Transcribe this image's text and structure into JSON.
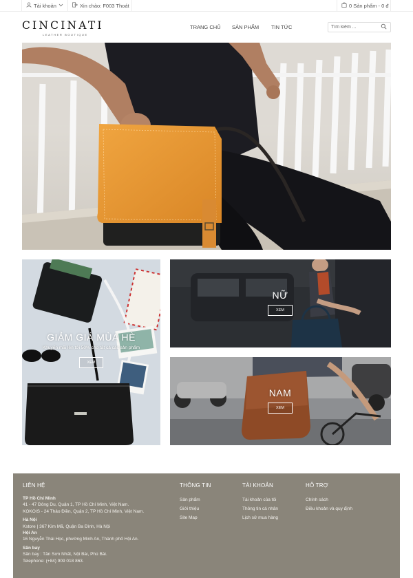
{
  "topbar": {
    "account_label": "Tài khoản",
    "greeting": "Xin chào: F003 Thoát",
    "cart": "0 Sản phẩm - 0 đ"
  },
  "header": {
    "brand": "CINCINATI",
    "tagline": "LEATHER BOUTIQUE",
    "nav": [
      "TRANG CHỦ",
      "SẢN PHẨM",
      "TIN TỨC"
    ],
    "search_placeholder": "Tìm kiếm ..."
  },
  "tiles": {
    "sale": {
      "title": "GIẢM GIÁ MÙA HÈ",
      "subtitle": "Khuyến mãi lên tới 50% cho tất cả các sản phẩm",
      "button": "XEM"
    },
    "women": {
      "title": "NỮ",
      "button": "XEM"
    },
    "men": {
      "title": "NAM",
      "button": "XEM"
    }
  },
  "footer": {
    "contact": {
      "heading": "LIÊN HỆ",
      "hcm_title": "TP Hồ Chí Minh",
      "hcm_1": "41 - 47 Đông Du, Quận 1, TP Hồ Chí Minh, Việt Nam.",
      "hcm_2": "KOKOIS - 24 Thảo Điền, Quận 2, TP Hồ Chí Minh, Việt Nam.",
      "hn_title": "Hà Nội",
      "hn_1": "Kstore | 367 Kim Mã, Quận Ba Đình, Hà Nội",
      "ha_title": "Hội An",
      "ha_1": "16 Nguyễn Thái Học, phường Minh An, Thành phố Hội An.",
      "ap_title": "Sân bay",
      "ap_1": "Sân bay : Tân Sơn Nhất, Nội Bài, Phú Bài.",
      "phone": "Telephone: (+84) 909 018 863."
    },
    "info": {
      "heading": "THÔNG TIN",
      "links": [
        "Sản phẩm",
        "Giới thiệu",
        "Site Map"
      ]
    },
    "account": {
      "heading": "TÀI KHOẢN",
      "links": [
        "Tài khoản của tôi",
        "Thông tin cá nhân",
        "Lịch sử mua hàng"
      ]
    },
    "support": {
      "heading": "HỖ TRỢ",
      "links": [
        "Chính sách",
        "Điều khoản và quy định"
      ]
    }
  },
  "colors": {
    "footer_bg": "#8a857a",
    "bag_tan": "#e7962f",
    "bag_brown": "#8e4a26"
  }
}
